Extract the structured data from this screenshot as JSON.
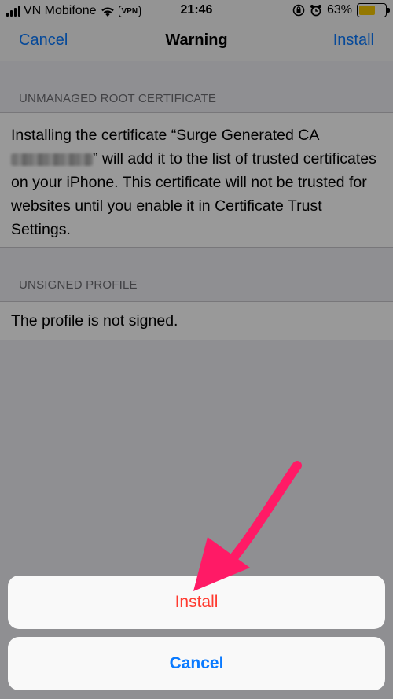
{
  "status_bar": {
    "carrier": "VN Mobifone",
    "vpn": "VPN",
    "time": "21:46",
    "battery": "63%"
  },
  "nav": {
    "cancel": "Cancel",
    "title": "Warning",
    "install": "Install"
  },
  "sections": {
    "root_cert": {
      "header": "UNMANAGED ROOT CERTIFICATE",
      "text_before": "Installing the certificate “Surge Generated CA",
      "text_after": "” will add it to the list of trusted certificates on your iPhone. This certificate will not be trusted for websites until you enable it in Certificate Trust Settings."
    },
    "unsigned": {
      "header": "UNSIGNED PROFILE",
      "text": "The profile is not signed."
    }
  },
  "action_sheet": {
    "install": "Install",
    "cancel": "Cancel"
  },
  "colors": {
    "ios_blue": "#0a7aff",
    "destructive_red": "#ff3b30",
    "annotation_arrow": "#ff1a66",
    "battery_yellow": "#f7c800"
  },
  "icons": [
    "wifi-icon",
    "orientation-lock-icon",
    "alarm-icon",
    "battery-icon",
    "annotation-arrow"
  ]
}
